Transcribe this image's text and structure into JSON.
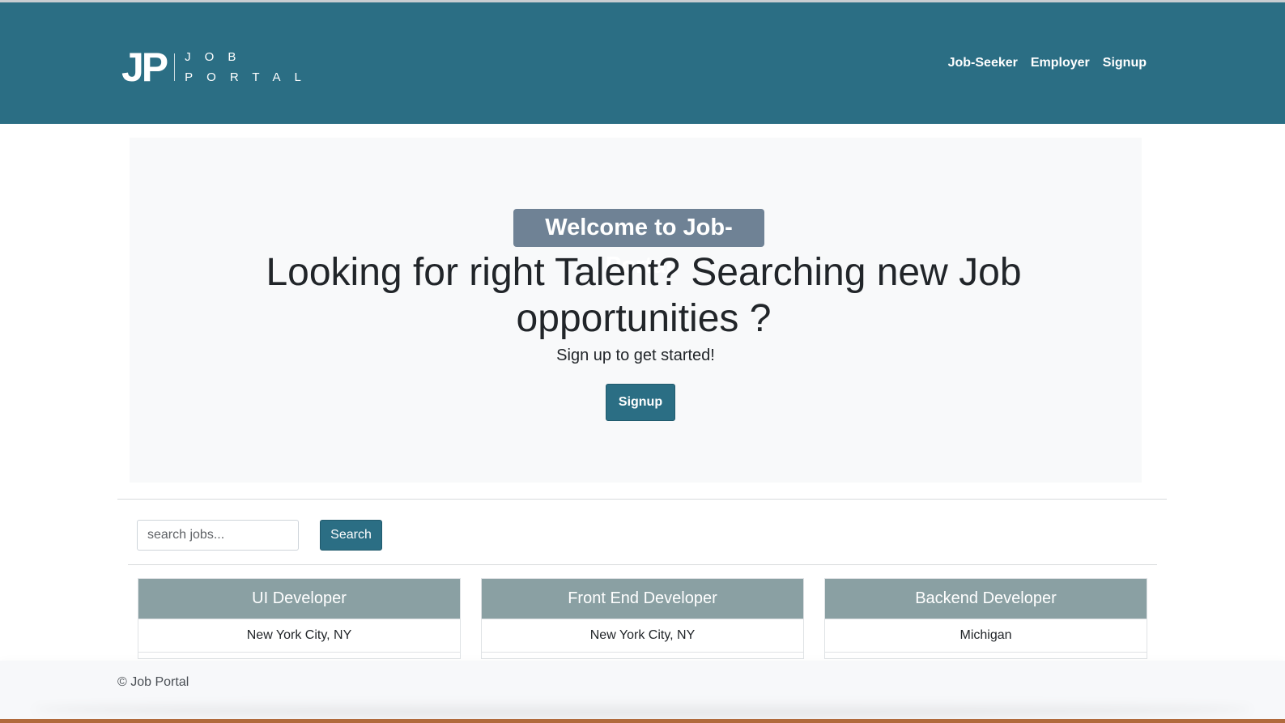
{
  "brand": {
    "logo_mark": "JP",
    "logo_word_top": "JOB",
    "logo_word_bottom": "PORTAL"
  },
  "nav": {
    "links": [
      "Job-Seeker",
      "Employer",
      "Signup"
    ]
  },
  "hero": {
    "badge": "Welcome to Job-Portal",
    "headline": "Looking for right Talent? Searching new Job opportunities ?",
    "subhead": "Sign up to get started!",
    "signup_label": "Signup"
  },
  "search": {
    "placeholder": "search jobs...",
    "button_label": "Search"
  },
  "jobs": [
    {
      "title": "UI Developer",
      "location": "New York City, NY"
    },
    {
      "title": "Front End Developer",
      "location": "New York City, NY"
    },
    {
      "title": "Backend Developer",
      "location": "Michigan"
    }
  ],
  "footer": {
    "text": "© Job Portal"
  },
  "colors": {
    "navbar": "#2b6e84",
    "badge": "#6f8295",
    "card_header": "#8aa0a3",
    "jumbotron": "#f8f9fa"
  }
}
